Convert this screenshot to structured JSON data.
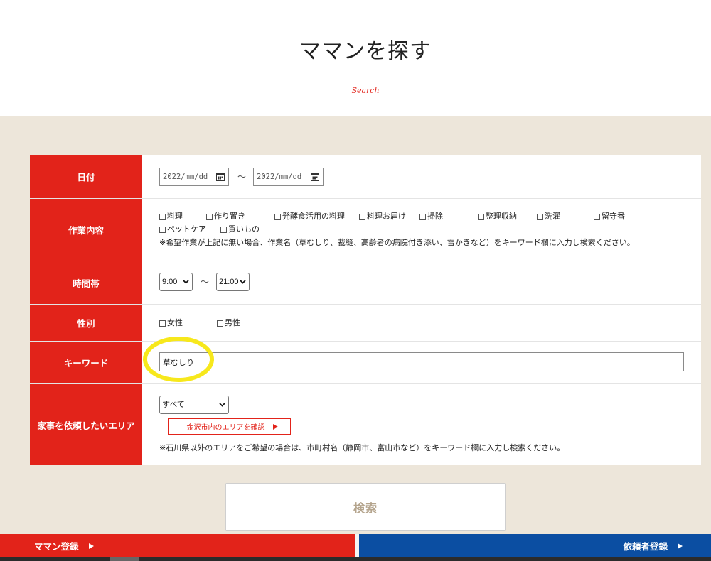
{
  "header": {
    "title": "ママンを探す",
    "subtitle": "Search"
  },
  "form": {
    "date": {
      "label": "日付",
      "from_value": "2022/mm/dd",
      "separator": "～",
      "to_value": "2022/mm/dd"
    },
    "tasks": {
      "label": "作業内容",
      "options": [
        "料理",
        "作り置き",
        "発酵食活用の料理",
        "料理お届け",
        "掃除",
        "整理収納",
        "洗濯",
        "留守番",
        "ペットケア",
        "買いもの"
      ],
      "note": "※希望作業が上記に無い場合、作業名（草むしり、裁縫、高齢者の病院付き添い、雪かきなど）をキーワード欄に入力し検索ください。"
    },
    "time": {
      "label": "時間帯",
      "from": "9:00",
      "separator": "～",
      "to": "21:00"
    },
    "gender": {
      "label": "性別",
      "options": [
        "女性",
        "男性"
      ]
    },
    "keyword": {
      "label": "キーワード",
      "value": "草むしり"
    },
    "area": {
      "label": "家事を依頼したいエリア",
      "selected": "すべて",
      "check_button": "金沢市内のエリアを確認",
      "note": "※石川県以外のエリアをご希望の場合は、市町村名（静岡市、富山市など）をキーワード欄に入力し検索ください。"
    }
  },
  "search_button": {
    "label": "検索"
  },
  "footer": {
    "left": {
      "label": "ママン登録"
    },
    "right": {
      "label": "依頼者登録"
    }
  },
  "icons": {
    "date_picker": "calendar-icon",
    "select": "chevron-down-icon",
    "arrow": "triangle-right-icon"
  },
  "colors": {
    "accent_red": "#e2231a",
    "background_beige": "#ede6da",
    "footer_blue": "#0b4ea2",
    "search_text": "#b5a58e",
    "highlight_yellow": "#f7e81c"
  }
}
